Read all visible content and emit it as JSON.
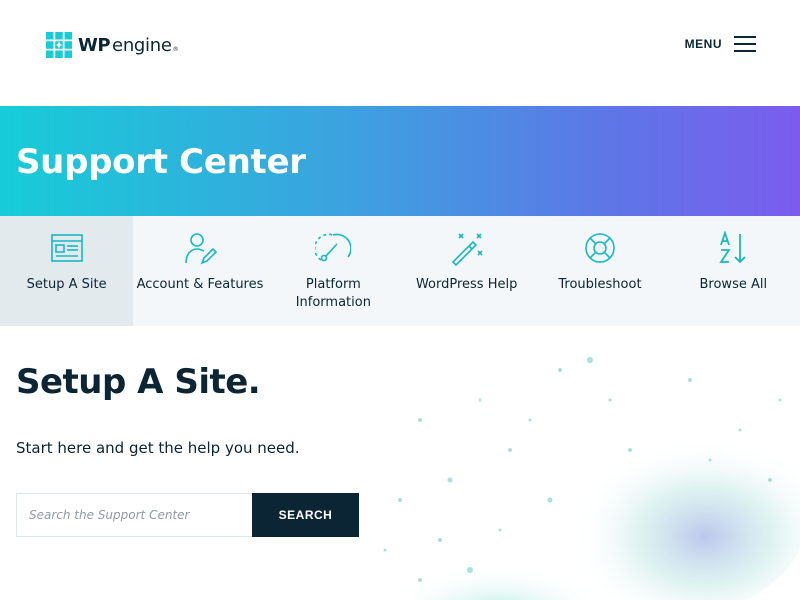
{
  "header": {
    "logo": {
      "brand_bold": "WP",
      "brand_light": "engine",
      "reg_mark": "®"
    },
    "menu_label": "MENU"
  },
  "hero": {
    "title": "Support Center"
  },
  "categories": [
    {
      "label": "Setup A Site",
      "icon": "browser-window-icon",
      "active": true
    },
    {
      "label": "Account & Features",
      "icon": "user-edit-icon",
      "active": false
    },
    {
      "label": "Platform Information",
      "icon": "gauge-icon",
      "active": false
    },
    {
      "label": "WordPress Help",
      "icon": "magic-wand-icon",
      "active": false
    },
    {
      "label": "Troubleshoot",
      "icon": "lifebuoy-icon",
      "active": false
    },
    {
      "label": "Browse All",
      "icon": "sort-az-icon",
      "active": false
    }
  ],
  "main": {
    "title": "Setup A Site.",
    "subtitle": "Start here and get the help you need.",
    "search": {
      "placeholder": "Search the Support Center",
      "value": "",
      "button_label": "SEARCH"
    }
  },
  "colors": {
    "navy": "#0b2535",
    "teal": "#17ccd7",
    "purple": "#7c5cee",
    "nav_bg": "#f4f7f9",
    "nav_active_bg": "#e3eaee"
  }
}
